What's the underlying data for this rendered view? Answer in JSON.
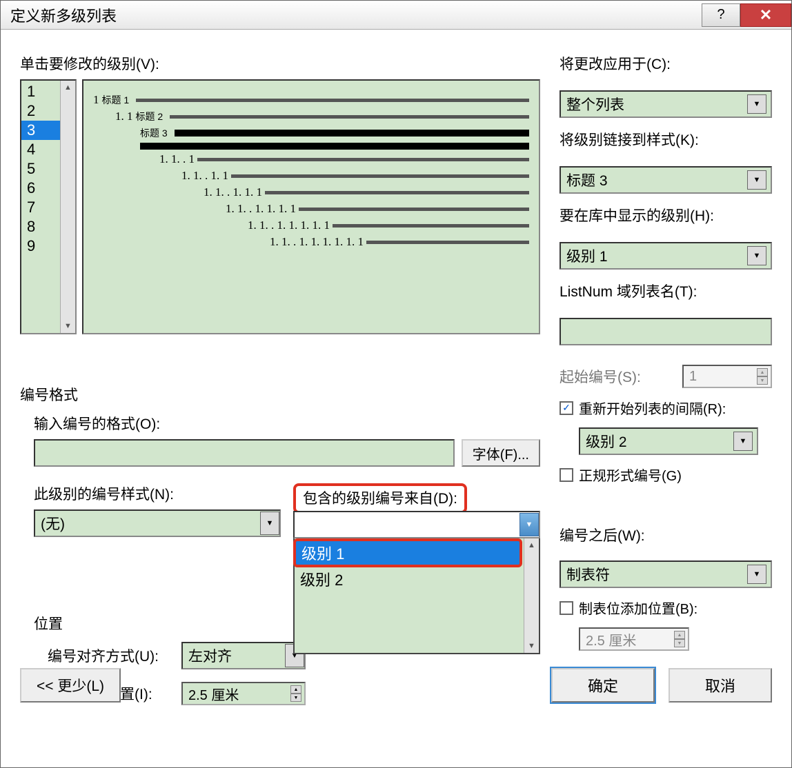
{
  "titlebar": {
    "title": "定义新多级列表"
  },
  "labels": {
    "click_level": "单击要修改的级别(V):",
    "apply_to": "将更改应用于(C):",
    "link_style": "将级别链接到样式(K):",
    "show_in_gallery": "要在库中显示的级别(H):",
    "listnum": "ListNum 域列表名(T):",
    "num_format_section": "编号格式",
    "enter_format": "输入编号的格式(O):",
    "font_btn": "字体(F)...",
    "num_style": "此级别的编号样式(N):",
    "include_from": "包含的级别编号来自(D):",
    "start_at": "起始编号(S):",
    "restart": "重新开始列表的间隔(R):",
    "legal": "正规形式编号(G)",
    "position_section": "位置",
    "align": "编号对齐方式(U):",
    "text_indent": "文本缩进位置(I):",
    "follow": "编号之后(W):",
    "tab_add": "制表位添加位置(B):",
    "less": "<< 更少(L)",
    "ok": "确定",
    "cancel": "取消"
  },
  "levels": [
    "1",
    "2",
    "3",
    "4",
    "5",
    "6",
    "7",
    "8",
    "9"
  ],
  "selected_level": "3",
  "preview": [
    {
      "indent": 0,
      "num": "1",
      "txt": "标题 1",
      "bar": "thin"
    },
    {
      "indent": 1,
      "num": "1. 1",
      "txt": "标题 2",
      "bar": "thin"
    },
    {
      "indent": 2,
      "num": "",
      "txt": "标题 3",
      "bar": "thick"
    },
    {
      "indent": 2,
      "num": "",
      "txt": "",
      "bar": "full"
    },
    {
      "indent": 3,
      "num": "1. 1. . 1",
      "txt": "",
      "bar": "thin"
    },
    {
      "indent": 4,
      "num": "1. 1. . 1. 1",
      "txt": "",
      "bar": "thin"
    },
    {
      "indent": 5,
      "num": "1. 1. . 1. 1. 1",
      "txt": "",
      "bar": "thin"
    },
    {
      "indent": 6,
      "num": "1. 1. . 1. 1. 1. 1",
      "txt": "",
      "bar": "thin"
    },
    {
      "indent": 7,
      "num": "1. 1. . 1. 1. 1. 1. 1",
      "txt": "",
      "bar": "thin"
    },
    {
      "indent": 8,
      "num": "1. 1. . 1. 1. 1. 1. 1. 1",
      "txt": "",
      "bar": "thin"
    }
  ],
  "right": {
    "apply_to_value": "整个列表",
    "link_style_value": "标题 3",
    "gallery_value": "级别 1",
    "listnum_value": ""
  },
  "num_style_value": "(无)",
  "dropdown": {
    "options": [
      "级别 1",
      "级别 2"
    ],
    "selected": "级别 1"
  },
  "start_value": "1",
  "restart_checked": true,
  "restart_value": "级别 2",
  "legal_checked": false,
  "align_value": "左对齐",
  "text_indent_value": "2.5 厘米",
  "follow_value": "制表符",
  "tab_add_checked": false,
  "tab_add_value": "2.5 厘米"
}
